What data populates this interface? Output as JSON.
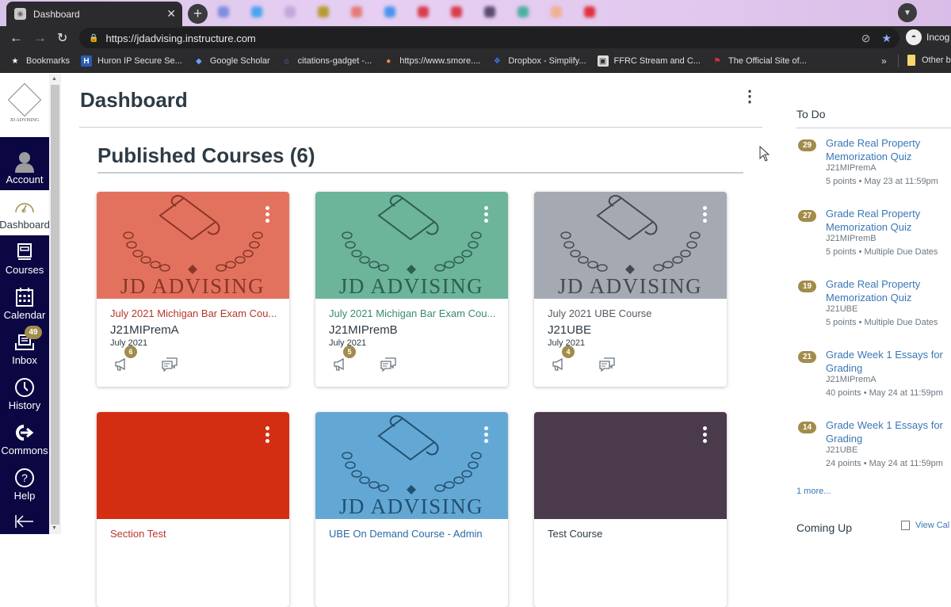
{
  "browser": {
    "tab_title": "Dashboard",
    "url": "https://jdadvising.instructure.com",
    "profile_label": "Incog",
    "bookmarks": [
      {
        "label": "Bookmarks",
        "icon": "star-icon"
      },
      {
        "label": "Huron IP Secure Se...",
        "icon": "h-icon"
      },
      {
        "label": "Google Scholar",
        "icon": "scholar-icon"
      },
      {
        "label": "citations-gadget -...",
        "icon": "house-icon"
      },
      {
        "label": "https://www.smore....",
        "icon": "flame-icon"
      },
      {
        "label": "Dropbox - Simplify...",
        "icon": "dropbox-icon"
      },
      {
        "label": "FFRC Stream and C...",
        "icon": "cat-icon"
      },
      {
        "label": "The Official Site of...",
        "icon": "mlb-icon"
      }
    ],
    "overflow_label": "»",
    "other_bookmarks": "Other b"
  },
  "brand": {
    "logo_text": "JD ADVISING"
  },
  "global_nav": [
    {
      "label": "Account",
      "icon": "account-icon"
    },
    {
      "label": "Dashboard",
      "icon": "dashboard-icon",
      "active": true
    },
    {
      "label": "Courses",
      "icon": "courses-icon"
    },
    {
      "label": "Calendar",
      "icon": "calendar-icon"
    },
    {
      "label": "Inbox",
      "icon": "inbox-icon",
      "badge": "49"
    },
    {
      "label": "History",
      "icon": "history-icon"
    },
    {
      "label": "Commons",
      "icon": "commons-icon"
    },
    {
      "label": "Help",
      "icon": "help-icon"
    }
  ],
  "page": {
    "title": "Dashboard",
    "section_title": "Published Courses (6)"
  },
  "courses": [
    {
      "title": "July 2021 Michigan Bar Exam Cou...",
      "code": "J21MIPremA",
      "term": "July 2021",
      "announcements": "6",
      "color": "#e2725e",
      "title_color": "#b5372a",
      "has_logo": true,
      "logo_color": "#8a3528"
    },
    {
      "title": "July 2021 Michigan Bar Exam Cou...",
      "code": "J21MIPremB",
      "term": "July 2021",
      "announcements": "5",
      "color": "#6cb49a",
      "title_color": "#3a8a73",
      "has_logo": true,
      "logo_color": "#2e5e50"
    },
    {
      "title": "July 2021 UBE Course",
      "code": "J21UBE",
      "term": "July 2021",
      "announcements": "4",
      "color": "#a5a9b1",
      "title_color": "#555b63",
      "has_logo": true,
      "logo_color": "#45494f"
    },
    {
      "title": "Section Test",
      "code": "",
      "term": "",
      "announcements": "",
      "color": "#d42e12",
      "title_color": "#b5372a",
      "has_logo": false
    },
    {
      "title": "UBE On Demand Course - Admin",
      "code": "",
      "term": "",
      "announcements": "",
      "color": "#63a8d4",
      "title_color": "#2b6aa6",
      "has_logo": true,
      "logo_color": "#234f70"
    },
    {
      "title": "Test Course",
      "code": "",
      "term": "",
      "announcements": "",
      "color": "#4a3a4c",
      "title_color": "#2d3b45",
      "has_logo": false
    }
  ],
  "todo": {
    "title": "To Do",
    "items": [
      {
        "count": "29",
        "title": "Grade Real Property Memorization Quiz",
        "course": "J21MIPremA",
        "meta": "5 points • May 23 at 11:59pm"
      },
      {
        "count": "27",
        "title": "Grade Real Property Memorization Quiz",
        "course": "J21MIPremB",
        "meta": "5 points • Multiple Due Dates"
      },
      {
        "count": "19",
        "title": "Grade Real Property Memorization Quiz",
        "course": "J21UBE",
        "meta": "5 points • Multiple Due Dates"
      },
      {
        "count": "21",
        "title": "Grade Week 1 Essays for Grading",
        "course": "J21MIPremA",
        "meta": "40 points • May 24 at 11:59pm"
      },
      {
        "count": "14",
        "title": "Grade Week 1 Essays for Grading",
        "course": "J21UBE",
        "meta": "24 points • May 24 at 11:59pm"
      }
    ],
    "more_label": "1 more..."
  },
  "coming_up": {
    "title": "Coming Up",
    "view_calendar": "View Cal"
  },
  "colors": {
    "nav_bg": "#0b0742",
    "badge": "#a28c4a",
    "link": "#3a77b5"
  }
}
